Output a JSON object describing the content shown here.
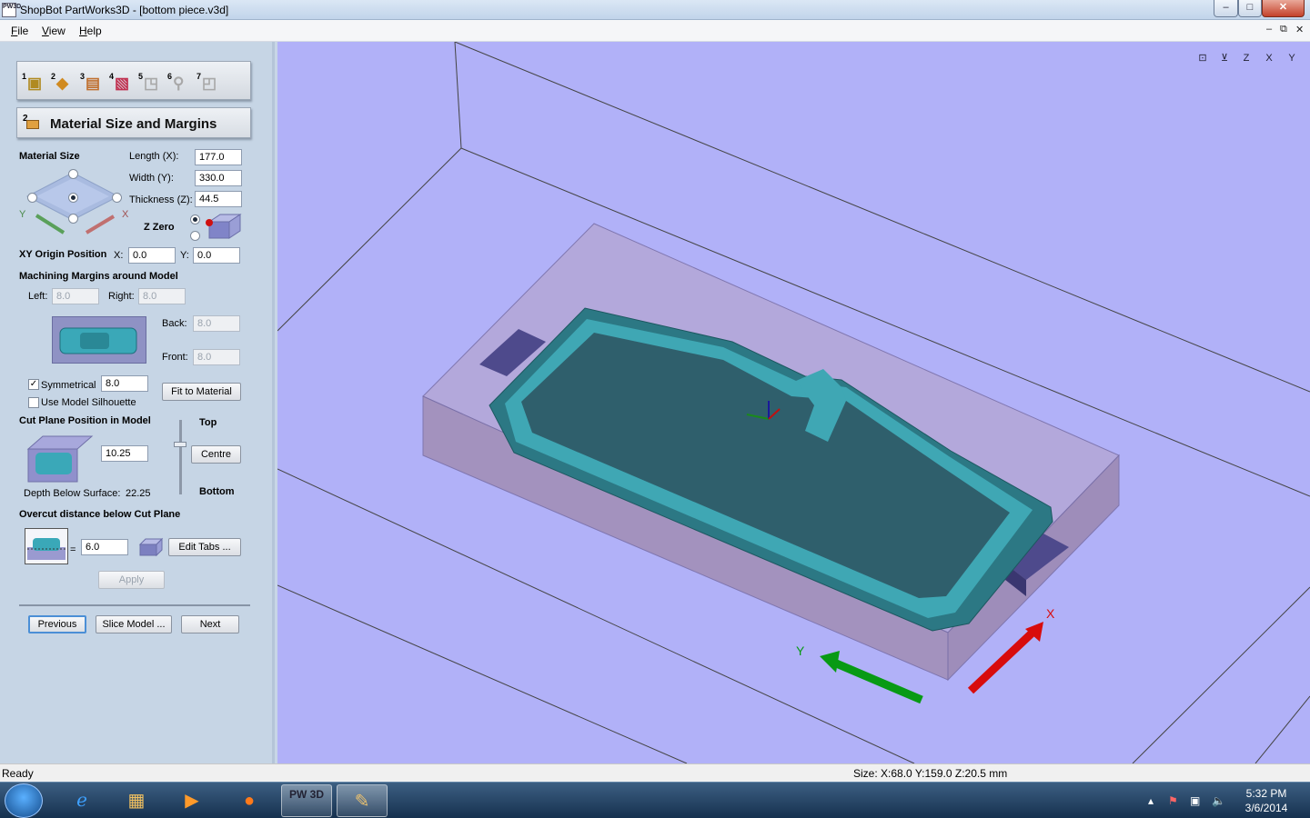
{
  "window": {
    "title": "ShopBot PartWorks3D - [bottom piece.v3d]",
    "icon_text": "PW3D",
    "min": "–",
    "max": "□",
    "close": "✕"
  },
  "menu": {
    "file": "File",
    "view": "View",
    "help": "Help",
    "mdi_min": "–",
    "mdi_restore": "⧉",
    "mdi_close": "✕"
  },
  "toolbar": {
    "tools": [
      "1",
      "2",
      "3",
      "4",
      "5",
      "6",
      "7"
    ]
  },
  "panel": {
    "title_num": "2",
    "title": "Material Size and Margins",
    "material_size_label": "Material Size",
    "length_label": "Length (X):",
    "length_value": "177.0",
    "width_label": "Width (Y):",
    "width_value": "330.0",
    "thickness_label": "Thickness (Z):",
    "thickness_value": "44.5",
    "zzero_label": "Z Zero",
    "axis_y": "Y",
    "axis_x": "X",
    "xy_origin_label": "XY Origin Position",
    "x_label": "X:",
    "x_value": "0.0",
    "y_label": "Y:",
    "y_value": "0.0",
    "margins_label": "Machining Margins around Model",
    "left_label": "Left:",
    "left_value": "8.0",
    "right_label": "Right:",
    "right_value": "8.0",
    "back_label": "Back:",
    "back_value": "8.0",
    "front_label": "Front:",
    "front_value": "8.0",
    "symmetrical_label": "Symmetrical",
    "symmetrical_value": "8.0",
    "symmetrical_checked": "✓",
    "silhouette_label": "Use Model Silhouette",
    "fit_button": "Fit to Material",
    "cutplane_label": "Cut Plane Position in Model",
    "top_label": "Top",
    "bottom_label": "Bottom",
    "cutplane_value": "10.25",
    "centre_button": "Centre",
    "depth_label": "Depth Below Surface:",
    "depth_value": "22.25",
    "overcut_label": "Overcut distance below Cut Plane",
    "overcut_eq": "=",
    "overcut_value": "6.0",
    "edit_tabs_button": "Edit Tabs ...",
    "apply_button": "Apply",
    "previous_button": "Previous",
    "slice_button": "Slice Model ...",
    "next_button": "Next"
  },
  "viewport": {
    "background": "#b1b1f8",
    "axis_x_label": "X",
    "axis_y_label": "Y",
    "view_icons": [
      "⊡",
      "⊻",
      "Z",
      "X",
      "Y"
    ]
  },
  "status": {
    "left": "Ready",
    "size": "Size: X:68.0 Y:159.0 Z:20.5 mm"
  },
  "taskbar": {
    "time": "5:32 PM",
    "date": "3/6/2014",
    "pw3d_label": "PW 3D"
  }
}
